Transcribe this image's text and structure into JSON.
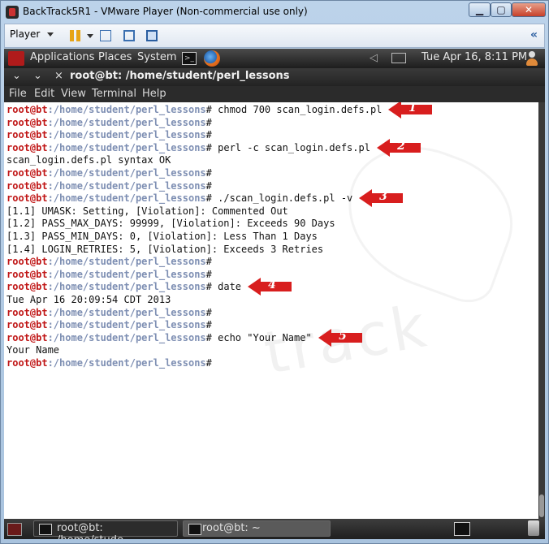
{
  "window": {
    "title": "BackTrack5R1 - VMware Player (Non-commercial use only)",
    "controls": {
      "minimize": "▁",
      "maximize": "▢",
      "close": "✕"
    }
  },
  "toolbar": {
    "player_label": "Player",
    "icons": [
      "pause-icon",
      "network-icon",
      "fit-guest-icon",
      "fullscreen-icon",
      "chevron-double-left-icon"
    ],
    "collapse": "«"
  },
  "gnome_panel": {
    "menus": [
      "Applications",
      "Places",
      "System"
    ],
    "clock": "Tue Apr 16,  8:11 PM",
    "tray_icons": [
      "volume-icon",
      "mail-icon",
      "user-icon"
    ]
  },
  "terminal": {
    "window_controls": [
      "⌄",
      "⌄",
      "×"
    ],
    "title": "root@bt: /home/student/perl_lessons",
    "menu": [
      "File",
      "Edit",
      "View",
      "Terminal",
      "Help"
    ],
    "prompt_user": "root@bt",
    "prompt_path": ":/home/student/perl_lessons",
    "prompt_end": "#",
    "watermark": "track",
    "lines": [
      {
        "type": "prompt",
        "cmd": " chmod 700 scan_login.defs.pl"
      },
      {
        "type": "prompt",
        "cmd": ""
      },
      {
        "type": "prompt",
        "cmd": ""
      },
      {
        "type": "prompt",
        "cmd": " perl -c scan_login.defs.pl"
      },
      {
        "type": "output",
        "text": "scan_login.defs.pl syntax OK"
      },
      {
        "type": "prompt",
        "cmd": ""
      },
      {
        "type": "prompt",
        "cmd": ""
      },
      {
        "type": "prompt",
        "cmd": " ./scan_login.defs.pl -v"
      },
      {
        "type": "output",
        "text": "[1.1] UMASK: Setting, [Violation]: Commented Out"
      },
      {
        "type": "output",
        "text": "[1.2] PASS_MAX_DAYS: 99999, [Violation]: Exceeds 90 Days"
      },
      {
        "type": "output",
        "text": "[1.3] PASS_MIN_DAYS: 0, [Violation]: Less Than 1 Days"
      },
      {
        "type": "output",
        "text": "[1.4] LOGIN_RETRIES: 5, [Violation]: Exceeds 3 Retries"
      },
      {
        "type": "prompt",
        "cmd": ""
      },
      {
        "type": "prompt",
        "cmd": ""
      },
      {
        "type": "prompt",
        "cmd": " date"
      },
      {
        "type": "output",
        "text": "Tue Apr 16 20:09:54 CDT 2013"
      },
      {
        "type": "prompt",
        "cmd": ""
      },
      {
        "type": "prompt",
        "cmd": ""
      },
      {
        "type": "prompt",
        "cmd": " echo \"Your Name\""
      },
      {
        "type": "output",
        "text": "Your Name"
      },
      {
        "type": "prompt",
        "cmd": ""
      }
    ],
    "annotations": [
      {
        "label": "1",
        "line": 0
      },
      {
        "label": "2",
        "line": 3
      },
      {
        "label": "3",
        "line": 7
      },
      {
        "label": "4",
        "line": 14
      },
      {
        "label": "5",
        "line": 18
      }
    ]
  },
  "taskbar": {
    "tasks": [
      {
        "label": "root@bt: /home/stude...",
        "active": false
      },
      {
        "label": "root@bt: ~",
        "active": true
      }
    ]
  },
  "colors": {
    "prompt_user": "#c01616",
    "prompt_path": "#7e8fb3",
    "annotation_arrow": "#d81e1e"
  }
}
